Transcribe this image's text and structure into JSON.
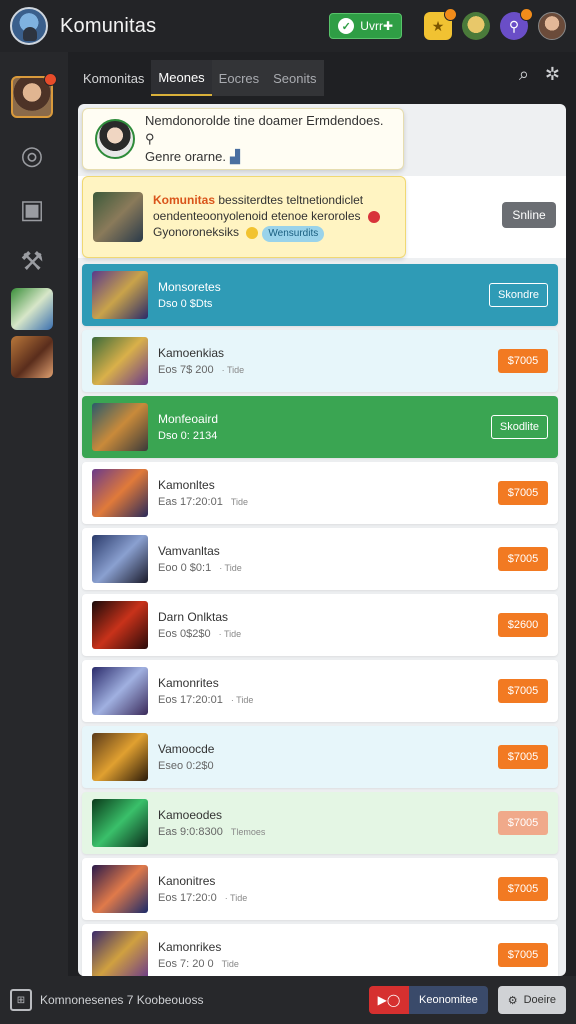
{
  "app": {
    "title": "Komunitas"
  },
  "topbar": {
    "action_label": "Uvrr✚",
    "icons": [
      "star-icon",
      "game-icon",
      "link-icon",
      "profile-avatar"
    ]
  },
  "tabs": [
    {
      "label": "Komonitas"
    },
    {
      "label": "Meones"
    },
    {
      "label": "Eocres"
    },
    {
      "label": "Seonits"
    }
  ],
  "notice": {
    "text": "Nemdonorolde tine doamer Ermdendoes.",
    "text2": "Genre orarne."
  },
  "promo": {
    "highlight": "Komunitas",
    "highlight2": "bessiterdtes",
    "text1": "teltnetiondiclet",
    "text2": "oendenteoonyolenoid etenoe keroroles",
    "text3": "Gyonoroneksiks",
    "tag": "Wensurdits",
    "button": "Snline"
  },
  "rows": [
    {
      "title": "Monsoretes",
      "sub": "Dso 0 $Dts",
      "meta": "",
      "price": "Skondre",
      "style": "teal"
    },
    {
      "title": "Kamoenkias",
      "sub": "Eos 7$ 200",
      "meta": "· Tide",
      "price": "$7005",
      "style": "aqua"
    },
    {
      "title": "Monfeoaird",
      "sub": "Dso 0: 2134",
      "meta": "",
      "price": "Skodlite",
      "style": "green"
    },
    {
      "title": "Kamonltes",
      "sub": "Eas 17:20:01",
      "meta": "Tide",
      "price": "$7005",
      "style": "white"
    },
    {
      "title": "Vamvanltas",
      "sub": "Eoo 0 $0:1",
      "meta": "· Tide",
      "price": "$7005",
      "style": "white"
    },
    {
      "title": "Darn Onlktas",
      "sub": "Eos 0$2$0",
      "meta": "· Tide",
      "price": "$2600",
      "style": "white"
    },
    {
      "title": "Kamonrites",
      "sub": "Eos 17:20:01",
      "meta": "· Tide",
      "price": "$7005",
      "style": "white"
    },
    {
      "title": "Vamoocde",
      "sub": "Eseo 0:2$0",
      "meta": "",
      "price": "$7005",
      "style": "aqua"
    },
    {
      "title": "Kamoeodes",
      "sub": "Eas 9:0:8300",
      "meta": "Tlemoes",
      "price": "$7005",
      "style": "mint"
    },
    {
      "title": "Kanonitres",
      "sub": "Eos 17:20:0",
      "meta": "· Tide",
      "price": "$7005",
      "style": "white"
    },
    {
      "title": "Kamonrikes",
      "sub": "Eos 7: 20 0",
      "meta": "Tide",
      "price": "$7005",
      "style": "white"
    }
  ],
  "bottombar": {
    "text": "Komnonesenes 7 Koobeouoss",
    "red_label": "Keonomitee",
    "button": "Doeire"
  },
  "colors": {
    "accent_orange": "#f27a22",
    "accent_green": "#3aa552",
    "accent_teal": "#2f9bb6"
  }
}
